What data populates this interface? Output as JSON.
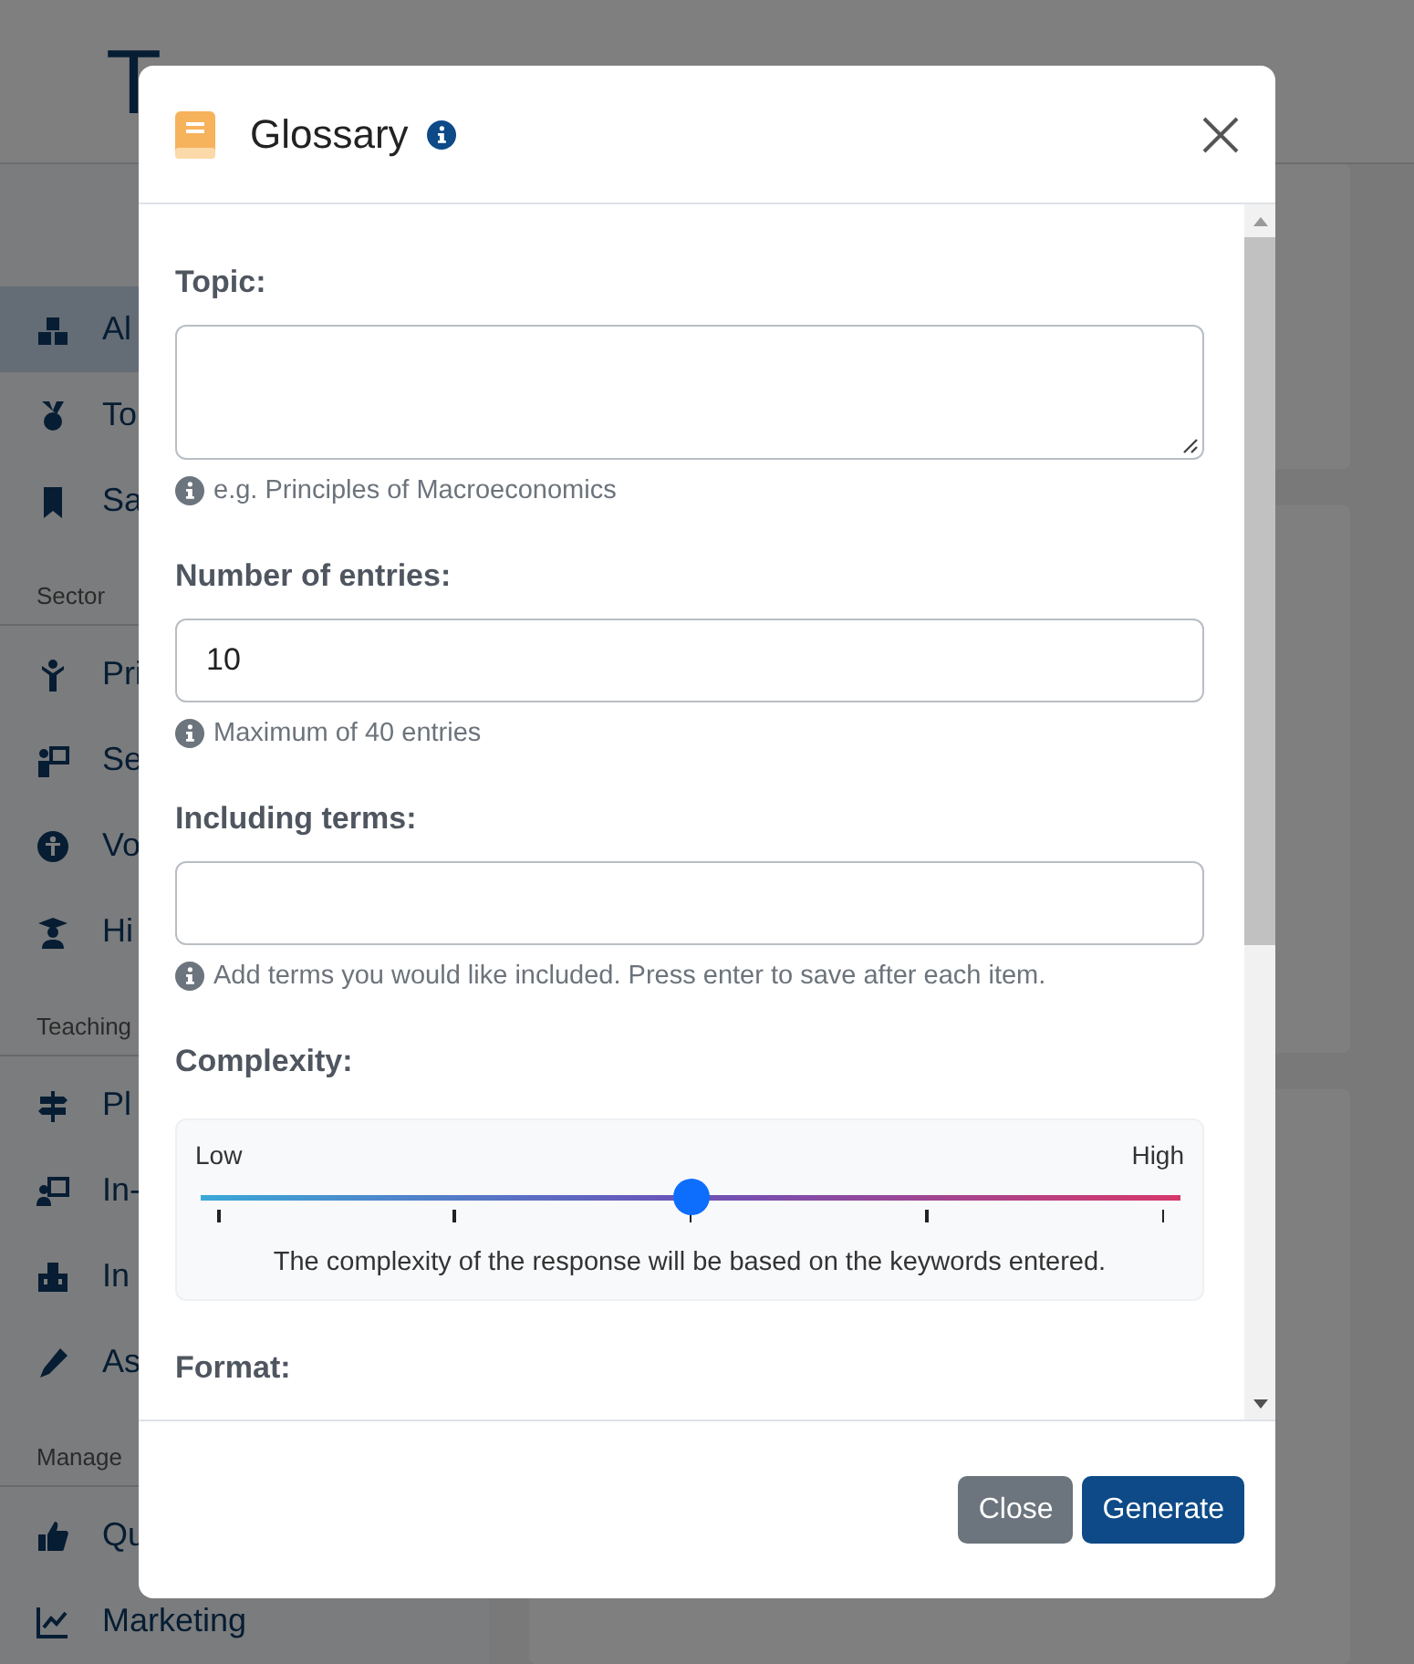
{
  "page": {
    "logo": "T",
    "sidebar": [
      {
        "items": [
          {
            "label": "Al",
            "selected": true
          },
          {
            "label": "To",
            "selected": false
          },
          {
            "label": "Sa",
            "selected": false
          }
        ]
      },
      {
        "title": "Sector",
        "items": [
          {
            "label": "Pri",
            "selected": false
          },
          {
            "label": "Se",
            "selected": false
          },
          {
            "label": "Vo",
            "selected": false
          },
          {
            "label": "Hi",
            "selected": false
          }
        ]
      },
      {
        "title": "Teaching",
        "items": [
          {
            "label": "Pl",
            "selected": false
          },
          {
            "label": "In-",
            "selected": false
          },
          {
            "label": "In",
            "selected": false
          },
          {
            "label": "As",
            "selected": false
          }
        ]
      },
      {
        "title": "Manage",
        "items": [
          {
            "label": "Qu",
            "selected": false
          },
          {
            "label": "Marketing",
            "selected": false
          }
        ]
      }
    ]
  },
  "dialog": {
    "title": "Glossary",
    "fields": [
      {
        "kind": "textarea",
        "label": "Topic:",
        "hint": "e.g. Principles of Macroeconomics"
      },
      {
        "kind": "input",
        "label": "Number of entries:",
        "value": "10",
        "hint": "Maximum of 40 entries"
      },
      {
        "kind": "input",
        "label": "Including terms:",
        "hint": "Add terms you would like included. Press enter to save after each item."
      },
      {
        "kind": "slider",
        "label": "Complexity:",
        "min_label": "Low",
        "max_label": "High",
        "level": 0.5,
        "note": "The complexity of the response will be based on the keywords entered."
      },
      {
        "kind": "heading",
        "label": "Format:"
      }
    ],
    "buttons": [
      {
        "label": "Close",
        "kind": "secondary"
      },
      {
        "label": "Generate",
        "kind": "primary"
      }
    ]
  }
}
